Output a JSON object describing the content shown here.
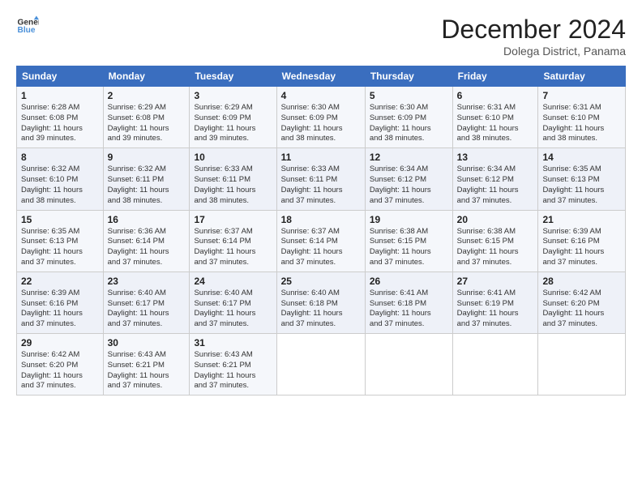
{
  "header": {
    "logo_line1": "General",
    "logo_line2": "Blue",
    "month": "December 2024",
    "location": "Dolega District, Panama"
  },
  "days_of_week": [
    "Sunday",
    "Monday",
    "Tuesday",
    "Wednesday",
    "Thursday",
    "Friday",
    "Saturday"
  ],
  "weeks": [
    [
      {
        "day": 1,
        "rise": "6:28 AM",
        "set": "6:08 PM",
        "hours": "11",
        "mins": "39"
      },
      {
        "day": 2,
        "rise": "6:29 AM",
        "set": "6:08 PM",
        "hours": "11",
        "mins": "39"
      },
      {
        "day": 3,
        "rise": "6:29 AM",
        "set": "6:09 PM",
        "hours": "11",
        "mins": "39"
      },
      {
        "day": 4,
        "rise": "6:30 AM",
        "set": "6:09 PM",
        "hours": "11",
        "mins": "38"
      },
      {
        "day": 5,
        "rise": "6:30 AM",
        "set": "6:09 PM",
        "hours": "11",
        "mins": "38"
      },
      {
        "day": 6,
        "rise": "6:31 AM",
        "set": "6:10 PM",
        "hours": "11",
        "mins": "38"
      },
      {
        "day": 7,
        "rise": "6:31 AM",
        "set": "6:10 PM",
        "hours": "11",
        "mins": "38"
      }
    ],
    [
      {
        "day": 8,
        "rise": "6:32 AM",
        "set": "6:10 PM",
        "hours": "11",
        "mins": "38"
      },
      {
        "day": 9,
        "rise": "6:32 AM",
        "set": "6:11 PM",
        "hours": "11",
        "mins": "38"
      },
      {
        "day": 10,
        "rise": "6:33 AM",
        "set": "6:11 PM",
        "hours": "11",
        "mins": "38"
      },
      {
        "day": 11,
        "rise": "6:33 AM",
        "set": "6:11 PM",
        "hours": "11",
        "mins": "37"
      },
      {
        "day": 12,
        "rise": "6:34 AM",
        "set": "6:12 PM",
        "hours": "11",
        "mins": "37"
      },
      {
        "day": 13,
        "rise": "6:34 AM",
        "set": "6:12 PM",
        "hours": "11",
        "mins": "37"
      },
      {
        "day": 14,
        "rise": "6:35 AM",
        "set": "6:13 PM",
        "hours": "11",
        "mins": "37"
      }
    ],
    [
      {
        "day": 15,
        "rise": "6:35 AM",
        "set": "6:13 PM",
        "hours": "11",
        "mins": "37"
      },
      {
        "day": 16,
        "rise": "6:36 AM",
        "set": "6:14 PM",
        "hours": "11",
        "mins": "37"
      },
      {
        "day": 17,
        "rise": "6:37 AM",
        "set": "6:14 PM",
        "hours": "11",
        "mins": "37"
      },
      {
        "day": 18,
        "rise": "6:37 AM",
        "set": "6:14 PM",
        "hours": "11",
        "mins": "37"
      },
      {
        "day": 19,
        "rise": "6:38 AM",
        "set": "6:15 PM",
        "hours": "11",
        "mins": "37"
      },
      {
        "day": 20,
        "rise": "6:38 AM",
        "set": "6:15 PM",
        "hours": "11",
        "mins": "37"
      },
      {
        "day": 21,
        "rise": "6:39 AM",
        "set": "6:16 PM",
        "hours": "11",
        "mins": "37"
      }
    ],
    [
      {
        "day": 22,
        "rise": "6:39 AM",
        "set": "6:16 PM",
        "hours": "11",
        "mins": "37"
      },
      {
        "day": 23,
        "rise": "6:40 AM",
        "set": "6:17 PM",
        "hours": "11",
        "mins": "37"
      },
      {
        "day": 24,
        "rise": "6:40 AM",
        "set": "6:17 PM",
        "hours": "11",
        "mins": "37"
      },
      {
        "day": 25,
        "rise": "6:40 AM",
        "set": "6:18 PM",
        "hours": "11",
        "mins": "37"
      },
      {
        "day": 26,
        "rise": "6:41 AM",
        "set": "6:18 PM",
        "hours": "11",
        "mins": "37"
      },
      {
        "day": 27,
        "rise": "6:41 AM",
        "set": "6:19 PM",
        "hours": "11",
        "mins": "37"
      },
      {
        "day": 28,
        "rise": "6:42 AM",
        "set": "6:20 PM",
        "hours": "11",
        "mins": "37"
      }
    ],
    [
      {
        "day": 29,
        "rise": "6:42 AM",
        "set": "6:20 PM",
        "hours": "11",
        "mins": "37"
      },
      {
        "day": 30,
        "rise": "6:43 AM",
        "set": "6:21 PM",
        "hours": "11",
        "mins": "37"
      },
      {
        "day": 31,
        "rise": "6:43 AM",
        "set": "6:21 PM",
        "hours": "11",
        "mins": "37"
      },
      null,
      null,
      null,
      null
    ]
  ]
}
